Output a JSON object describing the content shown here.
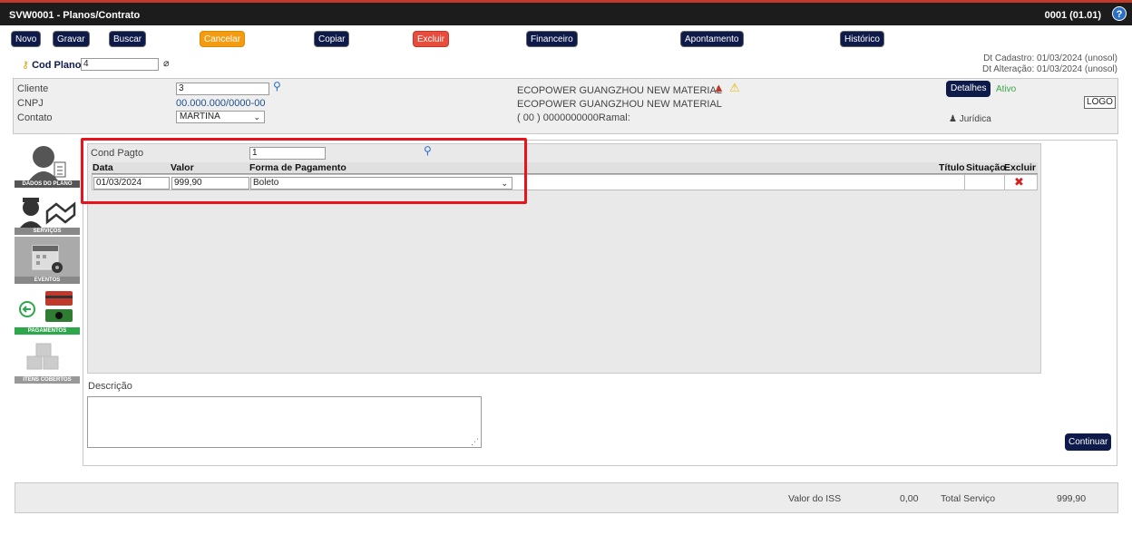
{
  "window": {
    "title": "SVW0001 - Planos/Contrato",
    "code": "0001 (01.01)",
    "help": "?"
  },
  "toolbar": {
    "novo": "Novo",
    "gravar": "Gravar",
    "buscar": "Buscar",
    "cancelar": "Cancelar",
    "copiar": "Copiar",
    "excluir": "Excluir",
    "financeiro": "Financeiro",
    "apontamento": "Apontamento",
    "historico": "Histórico"
  },
  "plano": {
    "label": "Cod Plano",
    "value": "4"
  },
  "dates": {
    "cadastro": "Dt Cadastro: 01/03/2024 (unosol)",
    "alteracao": "Dt Alteração: 01/03/2024 (unosol)"
  },
  "cliente": {
    "cliente_label": "Cliente",
    "cliente_value": "3",
    "cnpj_label": "CNPJ",
    "cnpj_value": "00.000.000/0000-00",
    "contato_label": "Contato",
    "contato_value": "MARTINA",
    "name1": "ECOPOWER GUANGZHOU NEW MATERIAL",
    "name2": "ECOPOWER GUANGZHOU NEW MATERIAL",
    "phone": "( 00 ) 0000000000Ramal:",
    "detalhes": "Detalhes",
    "status": "Ativo",
    "logo": "LOGO",
    "tipo": "Jurídica"
  },
  "sidebar": [
    {
      "caption": "DADOS DO PLANO",
      "icon": "user-document-icon"
    },
    {
      "caption": "SERVIÇOS",
      "icon": "worker-handshake-icon"
    },
    {
      "caption": "EVENTOS",
      "icon": "calendar-gear-icon"
    },
    {
      "caption": "PAGAMENTOS",
      "icon": "payment-cards-icon"
    },
    {
      "caption": "ITENS COBERTOS",
      "icon": "boxes-icon"
    }
  ],
  "payment": {
    "cond_label": "Cond Pagto",
    "cond_value": "1",
    "columns": [
      "Data",
      "Valor",
      "Forma de Pagamento",
      "Título",
      "Situação",
      "Excluir"
    ],
    "rows": [
      {
        "data": "01/03/2024",
        "valor": "999,90",
        "forma": "Boleto",
        "titulo": "",
        "situacao": ""
      }
    ]
  },
  "descricao": {
    "label": "Descrição",
    "value": ""
  },
  "continuar": "Continuar",
  "footer": {
    "iss_label": "Valor do ISS",
    "iss_value": "0,00",
    "total_label": "Total Serviço",
    "total_value": "999,90"
  },
  "colors": {
    "navy": "#0e1a4a",
    "orange": "#f39c12",
    "red": "#e74c3c",
    "highlight": "#e8131c"
  }
}
